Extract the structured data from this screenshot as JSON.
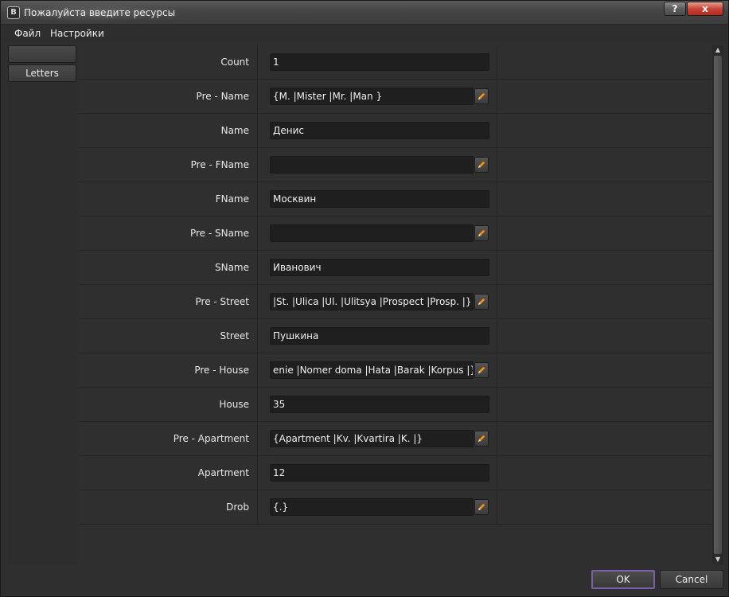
{
  "window": {
    "title": "Пожалуйста введите ресурсы",
    "app_icon_letter": "B",
    "help_label": "?",
    "close_label": "x"
  },
  "menu": {
    "items": [
      {
        "label": "Файл"
      },
      {
        "label": "Настройки"
      }
    ]
  },
  "side": {
    "tabs": [
      {
        "label": ""
      },
      {
        "label": "Letters"
      }
    ]
  },
  "form": {
    "rows": [
      {
        "label": "Count",
        "value": "1",
        "editable": false
      },
      {
        "label": "Pre - Name",
        "value": "{M. |Mister |Mr. |Man }",
        "editable": true
      },
      {
        "label": "Name",
        "value": "Денис",
        "editable": false
      },
      {
        "label": "Pre - FName",
        "value": "",
        "editable": true
      },
      {
        "label": "FName",
        "value": "Москвин",
        "editable": false
      },
      {
        "label": "Pre - SName",
        "value": "",
        "editable": true
      },
      {
        "label": "SName",
        "value": "Иванович",
        "editable": false
      },
      {
        "label": "Pre - Street",
        "value": "|St. |Ulica |Ul. |Ulitsya |Prospect |Prosp. |}",
        "editable": true
      },
      {
        "label": "Street",
        "value": "Пушкина",
        "editable": false
      },
      {
        "label": "Pre - House",
        "value": "enie |Nomer doma |Hata |Barak |Korpus |}",
        "editable": true
      },
      {
        "label": "House",
        "value": "35",
        "editable": false
      },
      {
        "label": "Pre - Apartment",
        "value": "{Apartment |Kv. |Kvartira |K. |}",
        "editable": true
      },
      {
        "label": "Apartment",
        "value": "12",
        "editable": false
      },
      {
        "label": "Drob",
        "value": "{.}",
        "editable": true
      }
    ]
  },
  "buttons": {
    "ok_label": "OK",
    "cancel_label": "Cancel"
  },
  "colors": {
    "accent_border": "#7a5fa3",
    "pencil": "#f0a020"
  }
}
